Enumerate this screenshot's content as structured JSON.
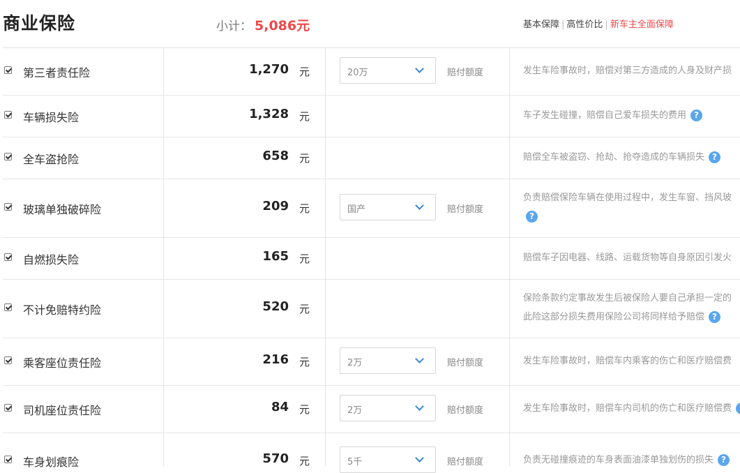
{
  "header": {
    "title": "商业保险",
    "subtotal_label": "小计：",
    "subtotal_amount": "5,086元",
    "plans": [
      "基本保障",
      "高性价比",
      "新车主全面保障"
    ],
    "plan_separator": "|"
  },
  "colors": {
    "accent_red": "#f04848",
    "help_blue": "#5aa6ee",
    "chevron_blue": "#3a86d6"
  },
  "rows": [
    {
      "name": "第三者责任险",
      "price": "1,270",
      "unit": "元",
      "checked": true,
      "select": "20万",
      "pay_label": "赔付额度",
      "desc": [
        "发生车险事故时，赔偿对第三方造成的人身及财产损"
      ],
      "help": false
    },
    {
      "name": "车辆损失险",
      "price": "1,328",
      "unit": "元",
      "checked": true,
      "desc": [
        "车子发生碰撞，赔偿自己爱车损失的费用"
      ],
      "help": true
    },
    {
      "name": "全车盗抢险",
      "price": "658",
      "unit": "元",
      "checked": true,
      "desc": [
        "赔偿全车被盗窃、抢劫、抢夺造成的车辆损失"
      ],
      "help": true
    },
    {
      "name": "玻璃单独破碎险",
      "price": "209",
      "unit": "元",
      "checked": true,
      "select": "国产",
      "pay_label": "赔付额度",
      "desc": [
        "负责赔偿保险车辆在使用过程中，发生车窗、挡风玻"
      ],
      "help": true
    },
    {
      "name": "自燃损失险",
      "price": "165",
      "unit": "元",
      "checked": true,
      "desc": [
        "赔偿车子因电器、线路、运载货物等自身原因引发火"
      ],
      "help": false
    },
    {
      "name": "不计免赔特约险",
      "price": "520",
      "unit": "元",
      "checked": true,
      "desc": [
        "保险条款约定事故发生后被保险人要自己承担一定的",
        "此险这部分损失费用保险公司将同样给予赔偿"
      ],
      "help": true
    },
    {
      "name": "乘客座位责任险",
      "price": "216",
      "unit": "元",
      "checked": true,
      "select": "2万",
      "pay_label": "赔付额度",
      "desc": [
        "发生车险事故时，赔偿车内乘客的伤亡和医疗赔偿费"
      ],
      "help": false
    },
    {
      "name": "司机座位责任险",
      "price": "84",
      "unit": "元",
      "checked": true,
      "select": "2万",
      "pay_label": "赔付额度",
      "desc": [
        "发生车险事故时，赔偿车内司机的伤亡和医疗赔偿费"
      ],
      "help": true
    },
    {
      "name": "车身划痕险",
      "price": "570",
      "unit": "元",
      "checked": true,
      "select": "5千",
      "pay_label": "赔付额度",
      "desc": [
        "负责无碰撞痕迹的车身表面油漆单独划伤的损失"
      ],
      "help": true
    }
  ]
}
